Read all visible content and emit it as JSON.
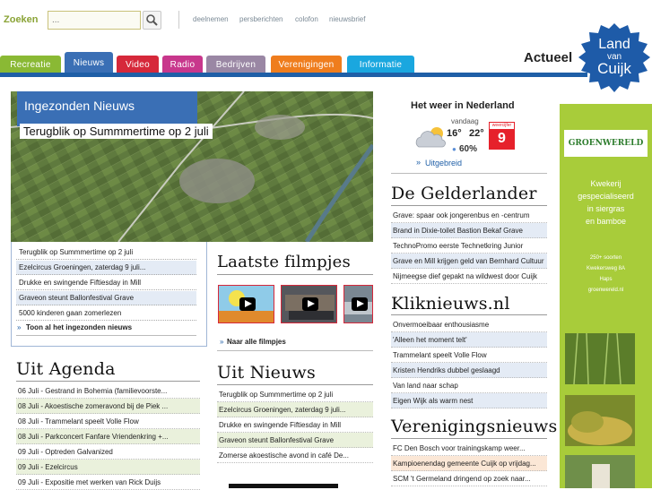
{
  "topbar": {
    "search_label": "Zoeken",
    "search_placeholder": "...",
    "links": [
      "deelnemen",
      "persberichten",
      "colofon",
      "nieuwsbrief"
    ]
  },
  "tabs": [
    {
      "label": "Recreatie",
      "color": "#8ab934"
    },
    {
      "label": "Nieuws",
      "color": "#3a6fb5"
    },
    {
      "label": "Video",
      "color": "#d6283a"
    },
    {
      "label": "Radio",
      "color": "#c8378c"
    },
    {
      "label": "Bedrijven",
      "color": "#9a87a4"
    },
    {
      "label": "Verenigingen",
      "color": "#ef7d1d"
    },
    {
      "label": "Informatie",
      "color": "#1aa7df"
    }
  ],
  "header": {
    "actueel": "Actueel",
    "logo_lines": [
      "Land",
      "van",
      "Cuijk"
    ]
  },
  "hero": {
    "badge": "Ingezonden Nieuws",
    "headline": "Terugblik op Summmertime op 2 juli"
  },
  "ingezonden": {
    "items": [
      "Terugblik op Summmertime op 2 juli",
      "Ezelcircus Groeningen, zaterdag 9 juli...",
      "Drukke en swingende Fiftiesday in Mill",
      "Graveon steunt Ballonfestival Grave",
      "5000 kinderen gaan zomerlezen"
    ],
    "more": "Toon al het ingezonden nieuws"
  },
  "filmpjes": {
    "title": "Laatste filmpjes",
    "more": "Naar alle filmpjes"
  },
  "agenda": {
    "title": "Uit Agenda",
    "items": [
      "06 Juli - Gestrand in Bohemia (familievoorste...",
      "08 Juli - Akoestische zomeravond bij de Piek ...",
      "08 Juli - Trammelant speelt Volle Flow",
      "08 Juli - Parkconcert Fanfare Vriendenkring +...",
      "09 Juli - Optreden Galvanized",
      "09 Juli - Ezelcircus",
      "09 Juli - Expositie met werken van Rick Duijs"
    ]
  },
  "uitnieuws": {
    "title": "Uit Nieuws",
    "items": [
      "Terugblik op Summmertime op 2 juli",
      "Ezelcircus Groeningen, zaterdag 9 juli...",
      "Drukke en swingende Fiftiesday in Mill",
      "Graveon steunt Ballonfestival Grave",
      "Zomerse akoestische avond in café De..."
    ]
  },
  "weather": {
    "title": "Het weer in Nederland",
    "day": "vandaag",
    "low": "16°",
    "high": "22°",
    "rain": "60%",
    "badge_label": "weercijfer",
    "score": "9",
    "more": "Uitgebreid"
  },
  "gelderlander": {
    "title": "De Gelderlander",
    "items": [
      "Grave: spaar ook jongerenbus en -centrum",
      "Brand in Dixie-toilet Bastion Bekaf Grave",
      "TechnoPromo eerste Technetkring Junior",
      "Grave en Mill krijgen geld van Bernhard Cultuur",
      "Nijmeegse dief gepakt na wildwest door Cuijk"
    ]
  },
  "kliknieuws": {
    "title": "Kliknieuws.nl",
    "items": [
      "Onvermoeibaar enthousiasme",
      "'Alleen het moment telt'",
      "Trammelant speelt Volle Flow",
      "Kristen Hendriks dubbel geslaagd",
      "Van land naar schap",
      "Eigen Wijk als warm nest"
    ]
  },
  "verenigingsnieuws": {
    "title": "Verenigingsnieuws",
    "items": [
      "FC Den Bosch voor trainingskamp weer...",
      "Kampioenendag gemeente Cuijk op vrijdag...",
      "SCM 't Germeland dringend op zoek naar..."
    ]
  },
  "ad": {
    "brand": "GROENWERELD",
    "lines": [
      "Kwekerij",
      "gespecialiseerd",
      "in siergras",
      "en bamboe"
    ],
    "small": [
      "250+ soorten",
      "Kwekersweg 8A",
      "Haps",
      "groenwereld.nl"
    ]
  }
}
